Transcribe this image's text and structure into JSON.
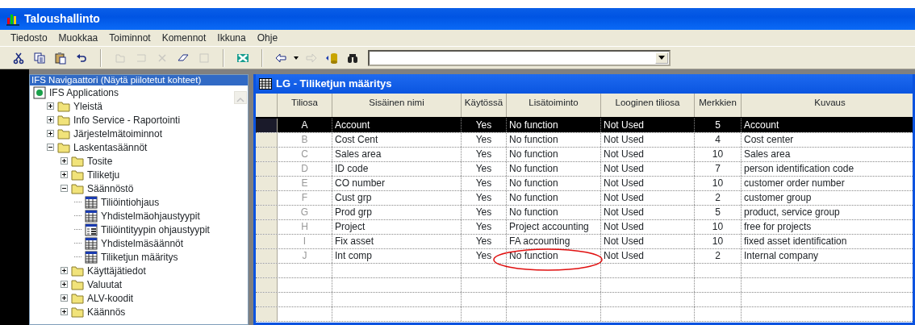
{
  "window": {
    "title": "Taloushallinto"
  },
  "menu": [
    "Tiedosto",
    "Muokkaa",
    "Toiminnot",
    "Komennot",
    "Ikkuna",
    "Ohje"
  ],
  "toolbar": [
    {
      "kind": "cut",
      "disabled": false
    },
    {
      "kind": "copy",
      "disabled": false
    },
    {
      "kind": "paste",
      "disabled": false
    },
    {
      "kind": "undo",
      "disabled": false
    },
    {
      "kind": "sep"
    },
    {
      "kind": "new",
      "disabled": true
    },
    {
      "kind": "duplicate",
      "disabled": true
    },
    {
      "kind": "delete",
      "disabled": true
    },
    {
      "kind": "eraser",
      "disabled": false
    },
    {
      "kind": "blank",
      "disabled": true
    },
    {
      "kind": "sep"
    },
    {
      "kind": "excel",
      "disabled": false
    },
    {
      "kind": "sep"
    },
    {
      "kind": "back",
      "disabled": false
    },
    {
      "kind": "forward",
      "disabled": true
    },
    {
      "kind": "database",
      "disabled": false
    },
    {
      "kind": "find",
      "disabled": false
    },
    {
      "kind": "combo"
    }
  ],
  "navigator": {
    "title": "IFS Navigaattori (Näytä piilotetut kohteet)",
    "tree": [
      {
        "label": "IFS Applications",
        "kind": "root",
        "children": [
          {
            "label": "Yleistä",
            "kind": "folder",
            "expanded": false
          },
          {
            "label": "Info Service - Raportointi",
            "kind": "folder",
            "expanded": false
          },
          {
            "label": "Järjestelmätoiminnot",
            "kind": "folder",
            "expanded": false
          },
          {
            "label": "Laskentasäännöt",
            "kind": "folder",
            "expanded": true,
            "children": [
              {
                "label": "Tosite",
                "kind": "folder",
                "expanded": false
              },
              {
                "label": "Tiliketju",
                "kind": "folder",
                "expanded": false
              },
              {
                "label": "Säännöstö",
                "kind": "folder",
                "expanded": true,
                "children": [
                  {
                    "label": "Tiliöintiohjaus",
                    "kind": "table"
                  },
                  {
                    "label": "Yhdistelmäohjaustyypit",
                    "kind": "table"
                  },
                  {
                    "label": "Tiliöintityypin ohjaustyypit",
                    "kind": "form"
                  },
                  {
                    "label": "Yhdistelmäsäännöt",
                    "kind": "table"
                  },
                  {
                    "label": "Tiliketjun määritys",
                    "kind": "table"
                  }
                ]
              },
              {
                "label": "Käyttäjätiedot",
                "kind": "folder",
                "expanded": false
              },
              {
                "label": "Valuutat",
                "kind": "folder",
                "expanded": false
              },
              {
                "label": "ALV-koodit",
                "kind": "folder",
                "expanded": false
              },
              {
                "label": "Käännös",
                "kind": "folder",
                "expanded": false
              }
            ]
          }
        ]
      }
    ]
  },
  "child_window": {
    "title": "LG - Tiliketjun määritys"
  },
  "table": {
    "columns": [
      "Tiliosa",
      "Sisäinen nimi",
      "Käytössä",
      "Lisätoiminto",
      "Looginen tiliosa",
      "Merkkien",
      "Kuvaus"
    ],
    "rows": [
      {
        "cells": [
          "A",
          "Account",
          "Yes",
          "No function",
          "Not Used",
          "5",
          "Account"
        ],
        "selected": true,
        "circled": false
      },
      {
        "cells": [
          "B",
          "Cost Cent",
          "Yes",
          "No function",
          "Not Used",
          "4",
          "Cost center"
        ],
        "selected": false,
        "circled": false
      },
      {
        "cells": [
          "C",
          "Sales area",
          "Yes",
          "No function",
          "Not Used",
          "10",
          "Sales area"
        ],
        "selected": false,
        "circled": false
      },
      {
        "cells": [
          "D",
          "ID code",
          "Yes",
          "No function",
          "Not Used",
          "7",
          "person identification code"
        ],
        "selected": false,
        "circled": false
      },
      {
        "cells": [
          "E",
          "CO number",
          "Yes",
          "No function",
          "Not Used",
          "10",
          "customer order number"
        ],
        "selected": false,
        "circled": false
      },
      {
        "cells": [
          "F",
          "Cust grp",
          "Yes",
          "No function",
          "Not Used",
          "2",
          "customer group"
        ],
        "selected": false,
        "circled": false
      },
      {
        "cells": [
          "G",
          "Prod grp",
          "Yes",
          "No function",
          "Not Used",
          "5",
          "product, service group"
        ],
        "selected": false,
        "circled": false
      },
      {
        "cells": [
          "H",
          "Project",
          "Yes",
          "Project accounting",
          "Not Used",
          "10",
          "free for projects"
        ],
        "selected": false,
        "circled": false
      },
      {
        "cells": [
          "I",
          "Fix asset",
          "Yes",
          "FA accounting",
          "Not Used",
          "10",
          "fixed asset identification"
        ],
        "selected": false,
        "circled": false
      },
      {
        "cells": [
          "J",
          "Int comp",
          "Yes",
          "No function",
          "Not Used",
          "2",
          "Internal company"
        ],
        "selected": false,
        "circled": true
      }
    ]
  }
}
